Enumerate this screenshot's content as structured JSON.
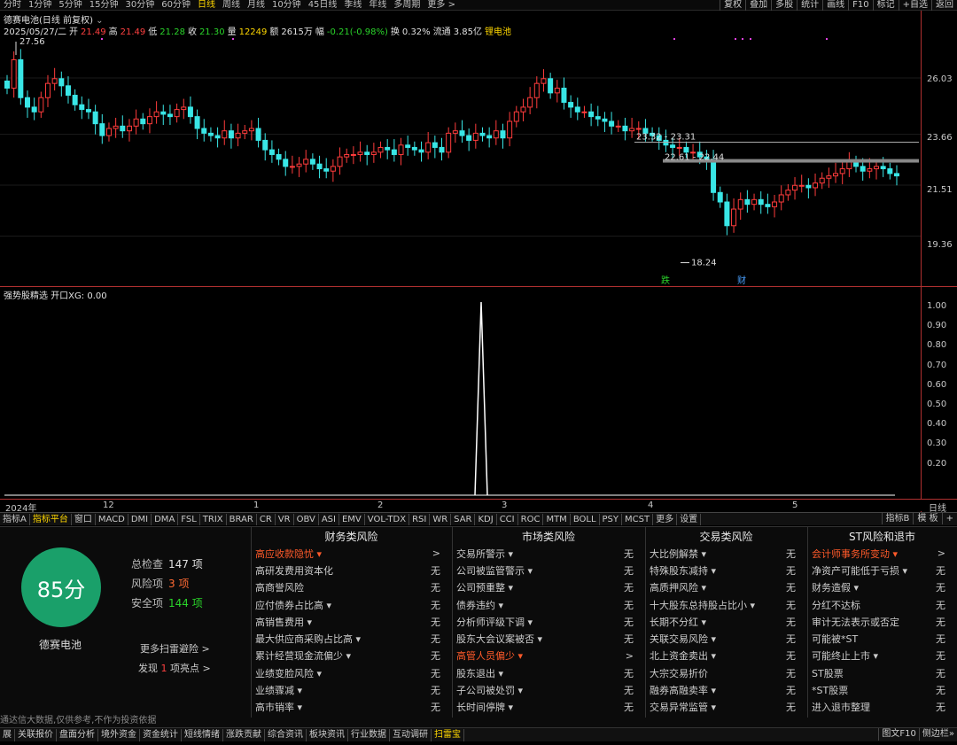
{
  "toolbar": {
    "periods": [
      "分时",
      "1分钟",
      "5分钟",
      "15分钟",
      "30分钟",
      "60分钟",
      "日线",
      "周线",
      "月线",
      "10分钟",
      "45日线",
      "季线",
      "年线",
      "多周期",
      "更多 >"
    ],
    "active_period": "日线",
    "right": [
      "复权",
      "叠加",
      "多股",
      "统计",
      "画线",
      "F10",
      "标记",
      "+自选",
      "返回"
    ]
  },
  "stock": {
    "title": "德赛电池(日线 前复权)",
    "date": "2025/05/27/二",
    "open_label": "开",
    "open": "21.49",
    "high_label": "高",
    "high": "21.49",
    "low_label": "低",
    "low": "21.28",
    "close_label": "收",
    "close": "21.30",
    "vol_label": "量",
    "vol": "12249",
    "amount_label": "额",
    "amount": "2615万",
    "chg_label": "幅",
    "chg": "-0.21(-0.98%)",
    "turnover_label": "换",
    "turnover": "0.32%",
    "float_label": "流通",
    "float": "3.85亿",
    "sector": "锂电池"
  },
  "chart_data": {
    "type": "candlestick",
    "yticks": [
      "26.03",
      "23.66",
      "21.51",
      "19.36"
    ],
    "annotations": {
      "high_label": "27.56",
      "low_label": "18.24",
      "zone1": "23.32 - 23.31",
      "zone2": "22.61 - 22.44",
      "tag1": "跌",
      "tag2": "财"
    },
    "indicator_title": "强势股精选",
    "indicator_value": "开口XG: 0.00",
    "indicator_yticks": [
      "1.00",
      "0.90",
      "0.80",
      "0.70",
      "0.60",
      "0.50",
      "0.40",
      "0.30",
      "0.20"
    ],
    "date_labels": [
      "2024年",
      "12",
      "1",
      "2",
      "3",
      "4",
      "5"
    ],
    "period_label": "日线",
    "closes": [
      25.6,
      26.8,
      25.2,
      24.8,
      24.6,
      25.2,
      25.8,
      26.0,
      25.7,
      25.3,
      24.9,
      24.7,
      24.6,
      24.1,
      23.6,
      23.9,
      24.0,
      23.8,
      24.0,
      24.3,
      24.1,
      24.4,
      24.6,
      24.5,
      24.4,
      24.7,
      24.8,
      24.4,
      23.9,
      23.7,
      23.6,
      23.5,
      23.8,
      23.5,
      23.7,
      23.8,
      23.9,
      23.4,
      23.0,
      22.8,
      22.6,
      22.3,
      22.3,
      22.4,
      22.6,
      22.4,
      22.2,
      22.1,
      22.3,
      22.7,
      22.8,
      22.8,
      22.9,
      22.8,
      22.9,
      23.1,
      23.0,
      22.8,
      23.2,
      23.1,
      23.0,
      22.9,
      23.3,
      23.1,
      22.9,
      23.7,
      23.8,
      23.6,
      23.4,
      23.7,
      23.6,
      23.5,
      23.8,
      23.5,
      24.2,
      24.6,
      24.8,
      25.2,
      25.8,
      26.0,
      25.4,
      25.6,
      25.0,
      24.8,
      24.6,
      24.6,
      24.4,
      24.3,
      24.2,
      24.0,
      24.0,
      23.8,
      23.9,
      23.9,
      23.7,
      23.6,
      23.4,
      23.2,
      23.1,
      23.1,
      22.9,
      22.9,
      22.7,
      22.6,
      21.2,
      20.8,
      19.8,
      20.5,
      20.9,
      20.7,
      20.9,
      20.7,
      20.6,
      20.8,
      21.1,
      21.3,
      21.5,
      21.5,
      21.4,
      21.6,
      21.8,
      21.9,
      22.0,
      22.2,
      22.5,
      22.3,
      22.1,
      22.2,
      22.3,
      22.2,
      22.0,
      21.9
    ]
  },
  "indicator_tabs": [
    "指标A",
    "指标平台",
    "窗口",
    "MACD",
    "DMI",
    "DMA",
    "FSL",
    "TRIX",
    "BRAR",
    "CR",
    "VR",
    "OBV",
    "ASI",
    "EMV",
    "VOL-TDX",
    "RSI",
    "WR",
    "SAR",
    "KDJ",
    "CCI",
    "ROC",
    "MTM",
    "BOLL",
    "PSY",
    "MCST",
    "更多",
    "设置"
  ],
  "indicator_tabs_active": "指标平台",
  "indicator_tabs_right": [
    "指标B",
    "模 板",
    "+"
  ],
  "risk": {
    "score": "85分",
    "name": "德赛电池",
    "total_label": "总检查",
    "total": "147 项",
    "risk_label": "风险项",
    "risk_count": "3 项",
    "safe_label": "安全项",
    "safe": "144 项",
    "more": "更多扫雷避险 >",
    "found_pre": "发现",
    "found_num": "1",
    "found_post": "项亮点 >",
    "disclaimer": "通达信大数据,仅供参考,不作为投资依据",
    "columns": [
      {
        "title": "财务类风险",
        "rows": [
          [
            "高应收款隐忧 ▾",
            ">",
            true
          ],
          [
            "高研发费用资本化",
            "无",
            false
          ],
          [
            "高商誉风险",
            "无",
            false
          ],
          [
            "应付债券占比高 ▾",
            "无",
            false
          ],
          [
            "高销售费用 ▾",
            "无",
            false
          ],
          [
            "最大供应商采购占比高 ▾",
            "无",
            false
          ],
          [
            "累计经营现金流偏少 ▾",
            "无",
            false
          ],
          [
            "业绩变脸风险 ▾",
            "无",
            false
          ],
          [
            "业绩骤减 ▾",
            "无",
            false
          ],
          [
            "高市销率 ▾",
            "无",
            false
          ]
        ]
      },
      {
        "title": "市场类风险",
        "rows": [
          [
            "交易所警示 ▾",
            "无",
            false
          ],
          [
            "公司被监管警示 ▾",
            "无",
            false
          ],
          [
            "公司预重整 ▾",
            "无",
            false
          ],
          [
            "债券违约 ▾",
            "无",
            false
          ],
          [
            "分析师评级下调 ▾",
            "无",
            false
          ],
          [
            "股东大会议案被否 ▾",
            "无",
            false
          ],
          [
            "高管人员偏少 ▾",
            ">",
            true
          ],
          [
            "股东退出 ▾",
            "无",
            false
          ],
          [
            "子公司被处罚 ▾",
            "无",
            false
          ],
          [
            "长时间停牌 ▾",
            "无",
            false
          ]
        ]
      },
      {
        "title": "交易类风险",
        "rows": [
          [
            "大比例解禁 ▾",
            "无",
            false
          ],
          [
            "特殊股东减持 ▾",
            "无",
            false
          ],
          [
            "高质押风险 ▾",
            "无",
            false
          ],
          [
            "十大股东总持股占比小 ▾",
            "无",
            false
          ],
          [
            "长期不分红 ▾",
            "无",
            false
          ],
          [
            "关联交易风险 ▾",
            "无",
            false
          ],
          [
            "北上资金卖出 ▾",
            "无",
            false
          ],
          [
            "大宗交易折价",
            "无",
            false
          ],
          [
            "融券高融卖率 ▾",
            "无",
            false
          ],
          [
            "交易异常监管 ▾",
            "无",
            false
          ]
        ]
      },
      {
        "title": "ST风险和退市",
        "rows": [
          [
            "会计师事务所变动 ▾",
            ">",
            true
          ],
          [
            "净资产可能低于亏损 ▾",
            "无",
            false
          ],
          [
            "财务造假 ▾",
            "无",
            false
          ],
          [
            "分红不达标",
            "无",
            false
          ],
          [
            "审计无法表示或否定",
            "无",
            false
          ],
          [
            "可能被*ST",
            "无",
            false
          ],
          [
            "可能终止上市 ▾",
            "无",
            false
          ],
          [
            "ST股票",
            "无",
            false
          ],
          [
            "*ST股票",
            "无",
            false
          ],
          [
            "进入退市整理",
            "无",
            false
          ]
        ]
      }
    ]
  },
  "statusbar": {
    "tabs": [
      "展",
      "关联报价",
      "盘面分析",
      "境外资金",
      "资金统计",
      "短线情绪",
      "涨跌贡献",
      "综合资讯",
      "板块资讯",
      "行业数据",
      "互动调研",
      "扫雷宝"
    ],
    "active": "扫雷宝",
    "right": [
      "图文F10",
      "侧边栏»"
    ]
  }
}
